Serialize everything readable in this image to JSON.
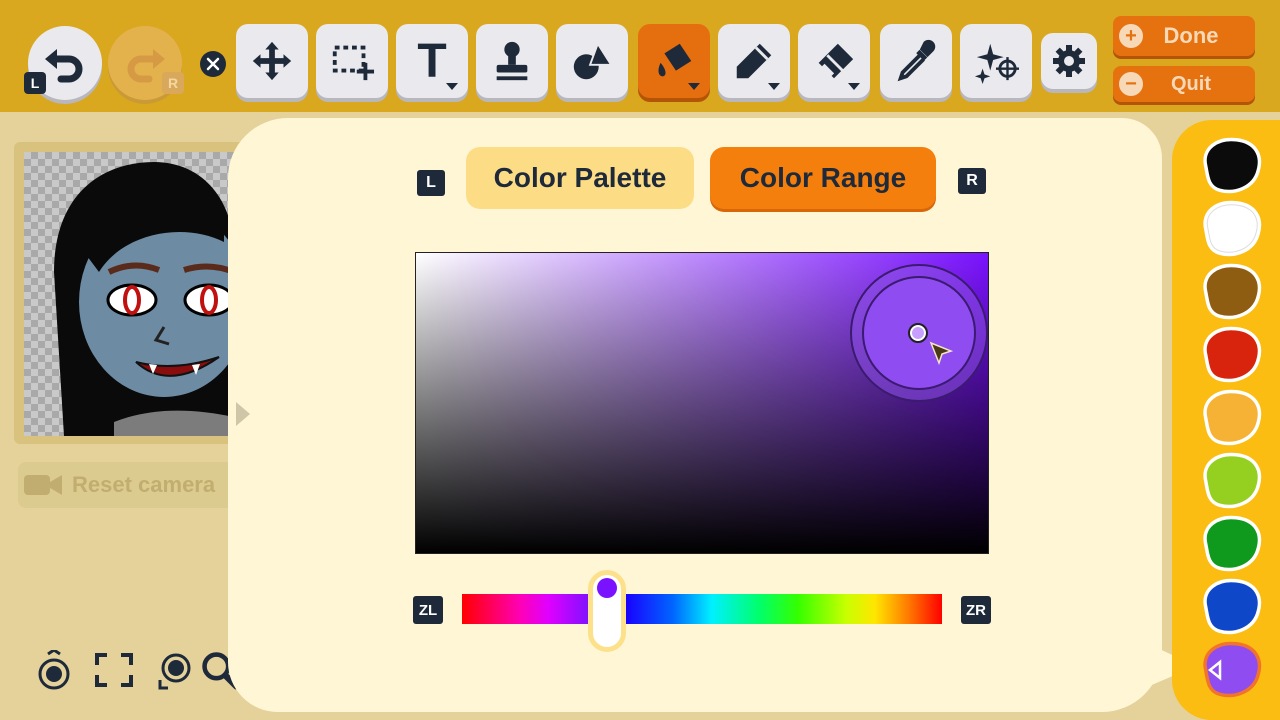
{
  "toolbar": {
    "undo_badge": "L",
    "redo_badge": "R",
    "tools": [
      {
        "name": "move",
        "icon": "move-arrows-icon",
        "has_submenu": false
      },
      {
        "name": "select",
        "icon": "selection-icon",
        "has_submenu": false
      },
      {
        "name": "text",
        "icon": "text-icon",
        "has_submenu": true
      },
      {
        "name": "stamp",
        "icon": "stamp-icon",
        "has_submenu": false
      },
      {
        "name": "shapes",
        "icon": "shapes-icon",
        "has_submenu": false
      },
      {
        "name": "fill",
        "icon": "paint-bucket-icon",
        "has_submenu": true,
        "active": true
      },
      {
        "name": "pen",
        "icon": "pen-icon",
        "has_submenu": true
      },
      {
        "name": "eraser",
        "icon": "eraser-icon",
        "has_submenu": true
      },
      {
        "name": "eyedropper",
        "icon": "eyedropper-icon",
        "has_submenu": false
      },
      {
        "name": "effects",
        "icon": "sparkle-icon",
        "has_submenu": false
      }
    ],
    "done_label": "Done",
    "quit_label": "Quit",
    "done_symbol": "+",
    "quit_symbol": "−",
    "text_tool_glyph": "T"
  },
  "left": {
    "reset_camera_label": "Reset camera"
  },
  "panel": {
    "tab_left_badge": "L",
    "tab_right_badge": "R",
    "tabs": [
      {
        "label": "Color Palette",
        "active": false
      },
      {
        "label": "Color Range",
        "active": true
      }
    ],
    "hue_left_badge": "ZL",
    "hue_right_badge": "ZR",
    "selected_hue_color": "#7a12ff",
    "selected_color": "#8f4cf1"
  },
  "swatches": [
    {
      "color": "#0b0b0b"
    },
    {
      "color": "#ffffff"
    },
    {
      "color": "#8f5d12"
    },
    {
      "color": "#d8240c"
    },
    {
      "color": "#f5b234"
    },
    {
      "color": "#95d021"
    },
    {
      "color": "#109a1d"
    },
    {
      "color": "#0e48c8"
    },
    {
      "color": "#8f4cf1",
      "selected": true
    }
  ]
}
